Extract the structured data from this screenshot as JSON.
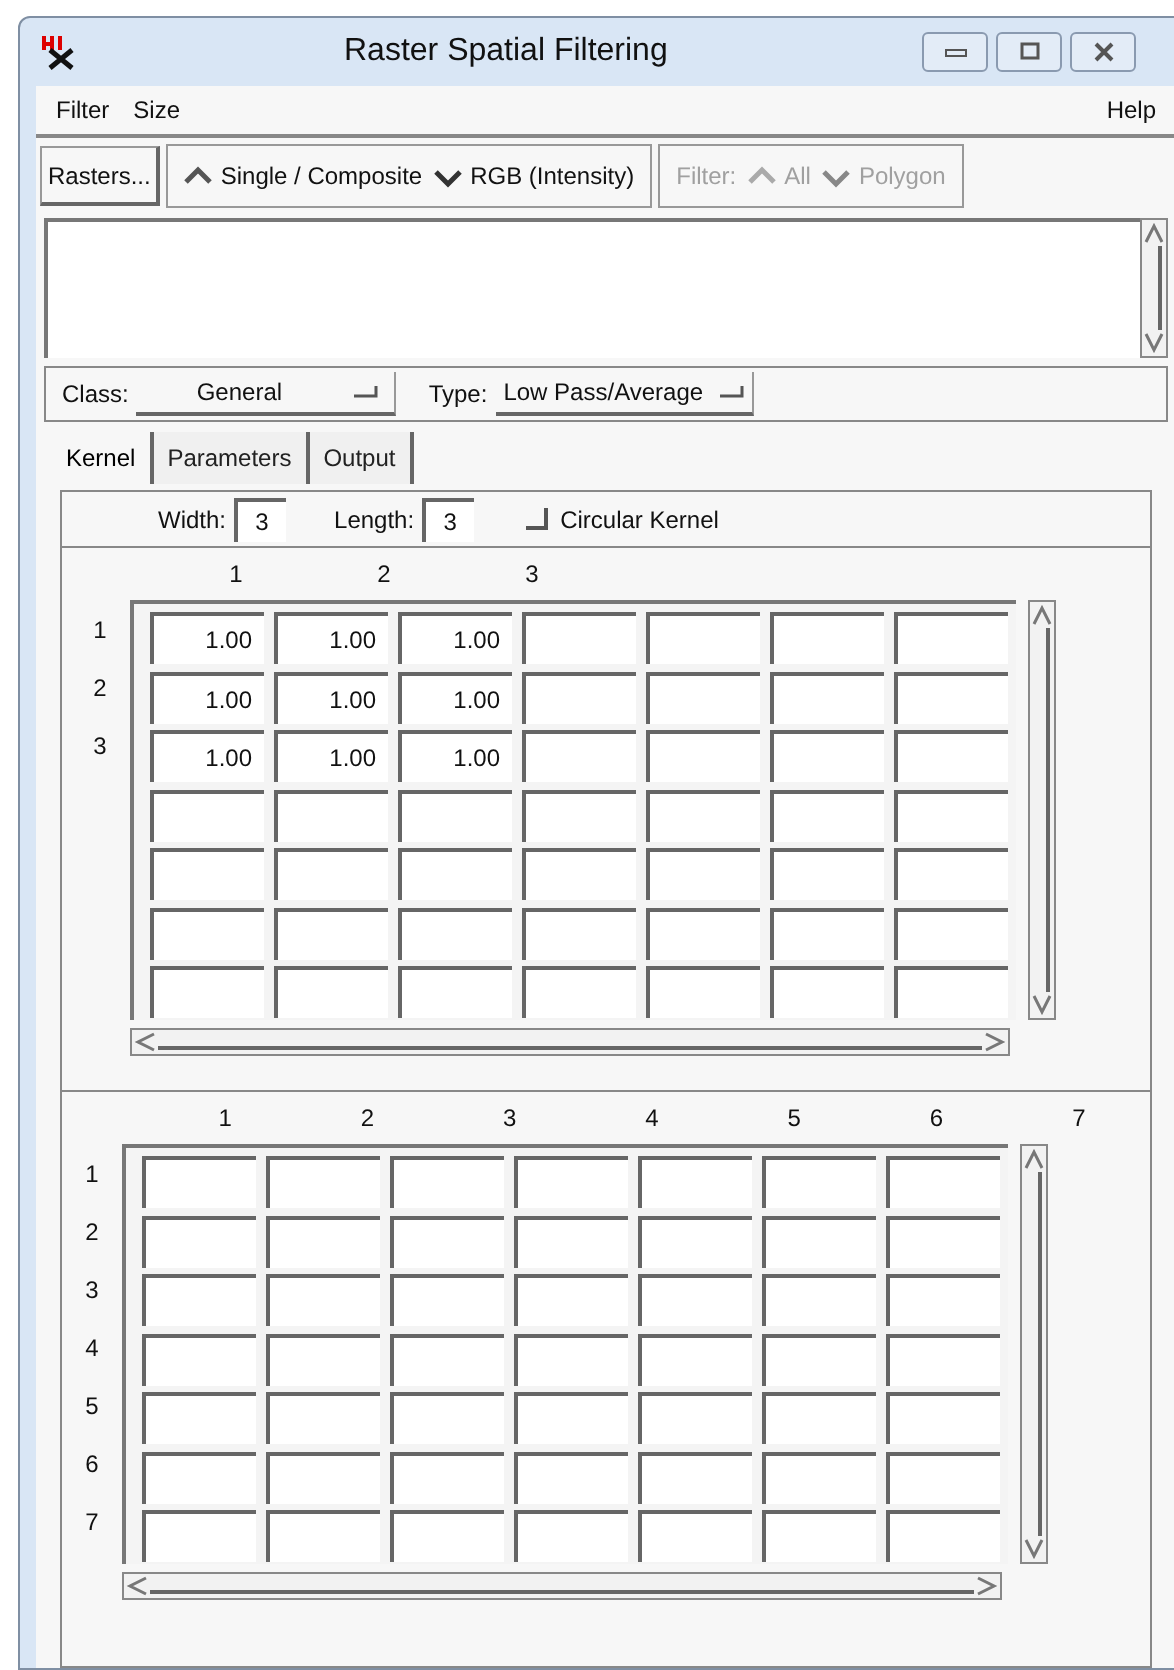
{
  "window": {
    "title": "Raster Spatial Filtering"
  },
  "menu": [
    {
      "label": "Filter"
    },
    {
      "label": "Size"
    },
    {
      "label": "Help"
    }
  ],
  "toolbar": {
    "rasters_button": "Rasters...",
    "mode_options": [
      {
        "label": "Single / Composite",
        "selected": true
      },
      {
        "label": "RGB (Intensity)",
        "selected": false
      }
    ],
    "filter": {
      "label": "Filter:",
      "disabled": true,
      "options": [
        {
          "label": "All",
          "selected": true
        },
        {
          "label": "Polygon",
          "selected": false
        }
      ]
    }
  },
  "class_row": {
    "class": {
      "label": "Class:",
      "value": "General"
    },
    "type": {
      "label": "Type:",
      "value": "Low Pass/Average"
    }
  },
  "tabs": [
    {
      "label": "Kernel",
      "selected": true
    },
    {
      "label": "Parameters",
      "selected": false
    },
    {
      "label": "Output",
      "selected": false
    }
  ],
  "kernel": {
    "width": {
      "label": "Width:",
      "value": "3"
    },
    "length": {
      "label": "Length:",
      "value": "3"
    },
    "circular": {
      "label": "Circular Kernel",
      "checked": false
    }
  },
  "grid_1": {
    "column_headers": [
      "1",
      "2",
      "3"
    ],
    "row_headers": [
      "1",
      "2",
      "3"
    ],
    "values": [
      [
        "1.00",
        "1.00",
        "1.00"
      ],
      [
        "1.00",
        "1.00",
        "1.00"
      ],
      [
        "1.00",
        "1.00",
        "1.00"
      ]
    ]
  },
  "grid_2": {
    "column_headers": [
      "1",
      "2",
      "3",
      "4",
      "5",
      "6",
      "7"
    ],
    "row_headers": [
      "1",
      "2",
      "3",
      "4",
      "5",
      "6",
      "7"
    ]
  }
}
